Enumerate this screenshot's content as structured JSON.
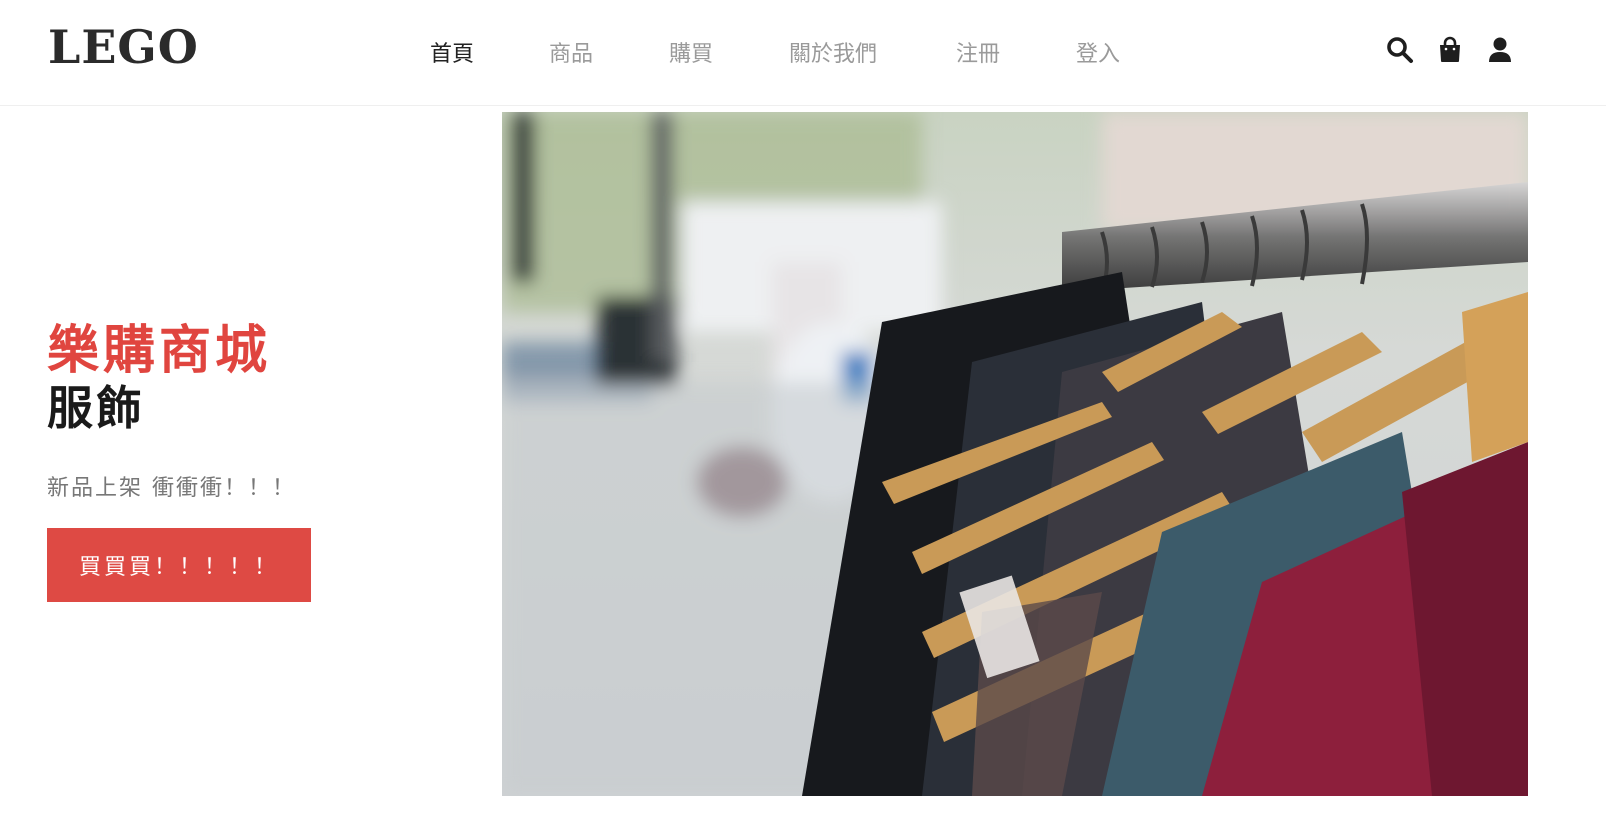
{
  "header": {
    "logo": "LEGO",
    "nav": [
      {
        "label": "首頁",
        "active": true
      },
      {
        "label": "商品",
        "active": false
      },
      {
        "label": "購買",
        "active": false
      },
      {
        "label": "關於我們",
        "active": false
      },
      {
        "label": "注冊",
        "active": false
      },
      {
        "label": "登入",
        "active": false
      }
    ],
    "icons": [
      "search-icon",
      "shopping-bag-icon",
      "user-icon"
    ]
  },
  "hero": {
    "title": "樂購商城",
    "subtitle": "服飾",
    "text": "新品上架 衝衝衝！！！",
    "button_label": "買買買！！！！！",
    "image": "clothes-rack-photo"
  },
  "colors": {
    "accent": "#de4a44",
    "title_red": "#e0453f",
    "nav_active": "#222222",
    "nav_inactive": "#9a9a9a"
  }
}
